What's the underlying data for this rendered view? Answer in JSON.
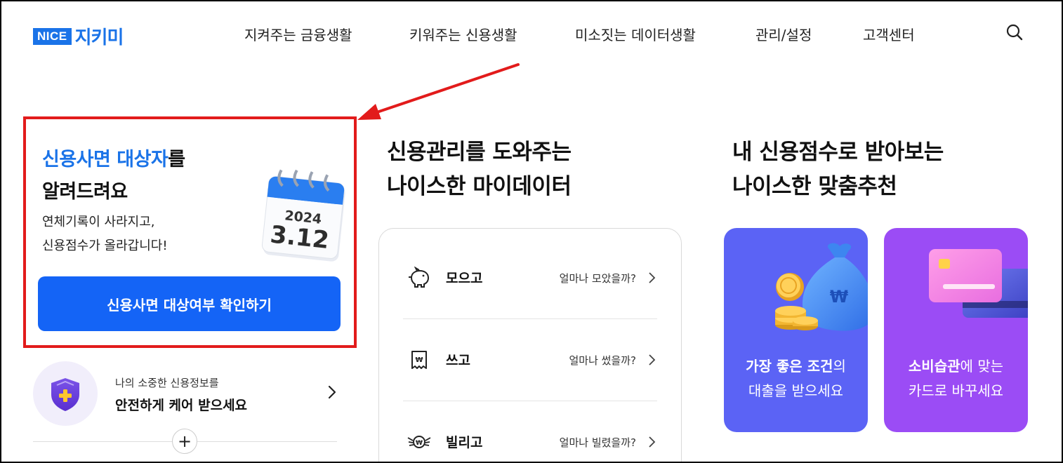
{
  "header": {
    "logo_badge": "NICE",
    "logo_text": "지키미",
    "nav": [
      "지켜주는 금융생활",
      "키워주는 신용생활",
      "미소짓는 데이터생활",
      "관리/설정",
      "고객센터"
    ]
  },
  "promo": {
    "title_highlight": "신용사면 대상자",
    "title_rest": "를",
    "title_line2": "알려드려요",
    "desc_line1": "연체기록이 사라지고,",
    "desc_line2": "신용점수가 올라갑니다!",
    "calendar_year": "2024",
    "calendar_date": "3.12",
    "button": "신용사면 대상여부 확인하기"
  },
  "care": {
    "sub": "나의 소중한 신용정보를",
    "main": "안전하게 케어 받으세요"
  },
  "mydata": {
    "title_line1": "신용관리를 도와주는",
    "title_line2": "나이스한 마이데이터",
    "rows": [
      {
        "label": "모으고",
        "question": "얼마나 모았을까?"
      },
      {
        "label": "쓰고",
        "question": "얼마나 썼을까?"
      },
      {
        "label": "빌리고",
        "question": "얼마나 빌렸을까?"
      }
    ]
  },
  "recommend": {
    "title_line1": "내 신용점수로 받아보는",
    "title_line2": "나이스한 맞춤추천",
    "cards": [
      {
        "bold": "가장 좋은 조건",
        "rest": "의",
        "line2": "대출을 받으세요"
      },
      {
        "bold": "소비습관",
        "rest": "에 맞는",
        "line2": "카드로 바꾸세요"
      }
    ]
  },
  "colors": {
    "brand_blue": "#1a73e8",
    "button_blue": "#1464f6",
    "highlight_red": "#e21b1b",
    "loan_card": "#5b63f5",
    "card_card": "#9b4cf5"
  }
}
